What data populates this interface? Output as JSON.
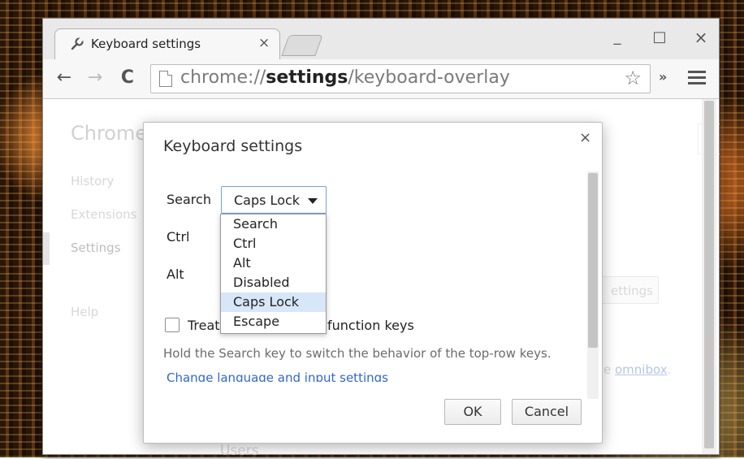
{
  "browser": {
    "tab": {
      "title": "Keyboard settings",
      "close_glyph": "×",
      "icon": "wrench-icon"
    },
    "window_controls": {
      "minimize": "_",
      "maximize": "□",
      "close": "×"
    },
    "toolbar": {
      "back_glyph": "←",
      "forward_glyph": "→",
      "reload_glyph": "C",
      "url_scheme": "chrome://",
      "url_host": "settings",
      "url_path": "/keyboard-overlay",
      "star_glyph": "☆",
      "extensions_glyph": "»"
    }
  },
  "settings_page": {
    "brand": "Chrome",
    "nav": [
      "History",
      "Extensions",
      "Settings",
      "Help"
    ],
    "background_button": "ettings",
    "background_text_prefix": "e ",
    "background_link": "omnibox",
    "background_text_suffix": ".",
    "background_section": "Users"
  },
  "dialog": {
    "title": "Keyboard settings",
    "close_glyph": "×",
    "rows": {
      "search": "Search",
      "ctrl": "Ctrl",
      "alt": "Alt"
    },
    "search_select_value": "Caps Lock",
    "dropdown_options": [
      "Search",
      "Ctrl",
      "Alt",
      "Disabled",
      "Caps Lock",
      "Escape"
    ],
    "selected_option": "Caps Lock",
    "checkbox_label_start": "Treat",
    "checkbox_label_end": "function keys",
    "checkbox_checked": false,
    "hint": "Hold the Search key to switch the behavior of the top-row keys.",
    "link": "Change language and input settings",
    "ok": "OK",
    "cancel": "Cancel"
  },
  "colors": {
    "accent_link": "#3366cc",
    "selected_option_bg": "#d7e6f8"
  }
}
